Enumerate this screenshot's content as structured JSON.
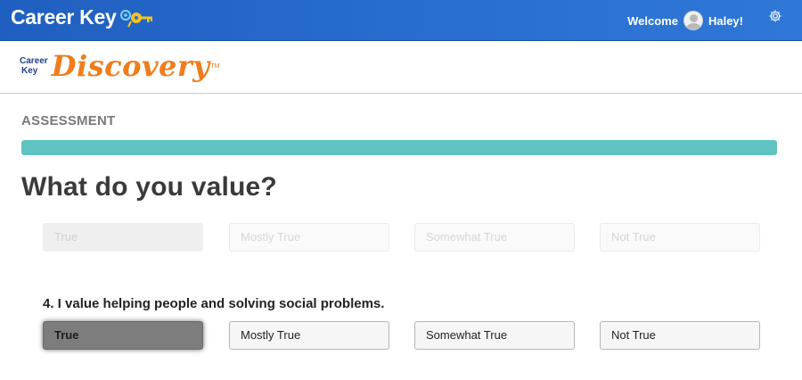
{
  "topbar": {
    "brand": "Career Key",
    "welcome_label": "Welcome",
    "user_name": "Haley!",
    "icons": {
      "brand_key": "key-icon",
      "avatar": "avatar-icon",
      "settings": "gear-icon"
    }
  },
  "subheader": {
    "logo_small_line1": "Career",
    "logo_small_line2": "Key",
    "logo_big": "Discovery",
    "logo_tm": "TM"
  },
  "assessment": {
    "section_label": "ASSESSMENT",
    "progress_fraction": 1.0,
    "title": "What do you value?",
    "previous_question": {
      "options": [
        "True",
        "Mostly True",
        "Somewhat True",
        "Not True"
      ],
      "selected": "True"
    },
    "current_question": {
      "text": "4. I value helping people and solving social problems.",
      "options": [
        "True",
        "Mostly True",
        "Somewhat True",
        "Not True"
      ],
      "selected": "True"
    }
  },
  "colors": {
    "topbar": "#2a6fd0",
    "progress_fill": "#5fc4c1",
    "logo_orange": "#f07d1c",
    "selected_option": "#7d7d7d"
  }
}
